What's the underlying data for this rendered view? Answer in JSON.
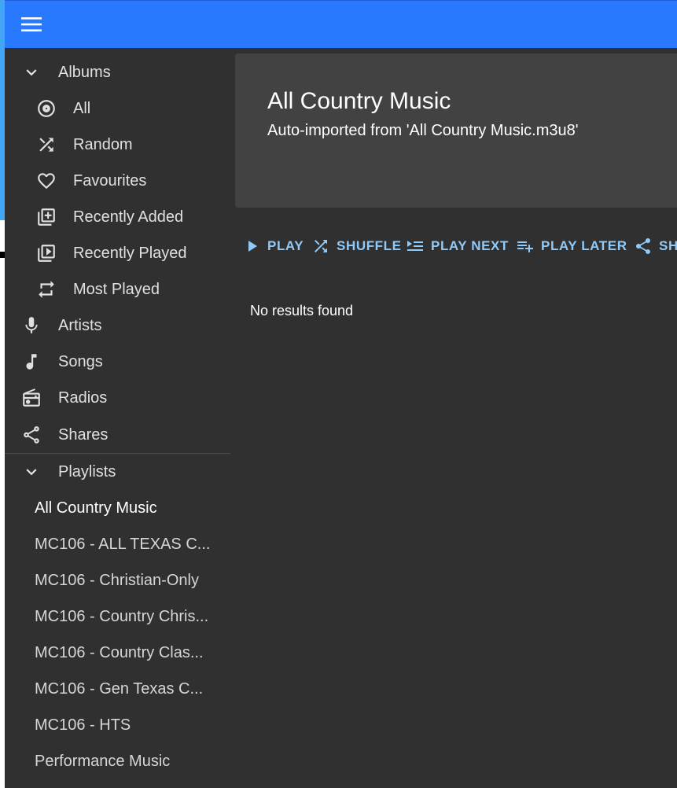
{
  "colors": {
    "appbar": "#2979ff",
    "accent": "#90caf9",
    "background": "#303030",
    "card": "#424242"
  },
  "appbar": {
    "menu_icon": "menu-icon"
  },
  "sidebar": {
    "albums": {
      "label": "Albums",
      "items": [
        {
          "label": "All",
          "icon": "album-icon"
        },
        {
          "label": "Random",
          "icon": "shuffle-icon"
        },
        {
          "label": "Favourites",
          "icon": "heart-icon"
        },
        {
          "label": "Recently Added",
          "icon": "library-add-icon"
        },
        {
          "label": "Recently Played",
          "icon": "video-library-icon"
        },
        {
          "label": "Most Played",
          "icon": "repeat-icon"
        }
      ]
    },
    "main_items": [
      {
        "label": "Artists",
        "icon": "mic-icon"
      },
      {
        "label": "Songs",
        "icon": "music-note-icon"
      },
      {
        "label": "Radios",
        "icon": "radio-icon"
      },
      {
        "label": "Shares",
        "icon": "share-icon"
      }
    ],
    "playlists": {
      "label": "Playlists",
      "items": [
        {
          "label": "All Country Music"
        },
        {
          "label": "MC106 - ALL TEXAS C..."
        },
        {
          "label": "MC106 - Christian-Only"
        },
        {
          "label": "MC106 - Country Chris..."
        },
        {
          "label": "MC106 - Country Clas..."
        },
        {
          "label": "MC106 - Gen Texas C..."
        },
        {
          "label": "MC106 - HTS"
        },
        {
          "label": "Performance Music"
        }
      ]
    }
  },
  "playlist": {
    "title": "All Country Music",
    "subtitle": "Auto-imported from 'All Country Music.m3u8'"
  },
  "toolbar": {
    "play": "PLAY",
    "shuffle": "SHUFFLE",
    "play_next": "PLAY NEXT",
    "play_later": "PLAY LATER",
    "share": "SH"
  },
  "content": {
    "empty_message": "No results found"
  }
}
